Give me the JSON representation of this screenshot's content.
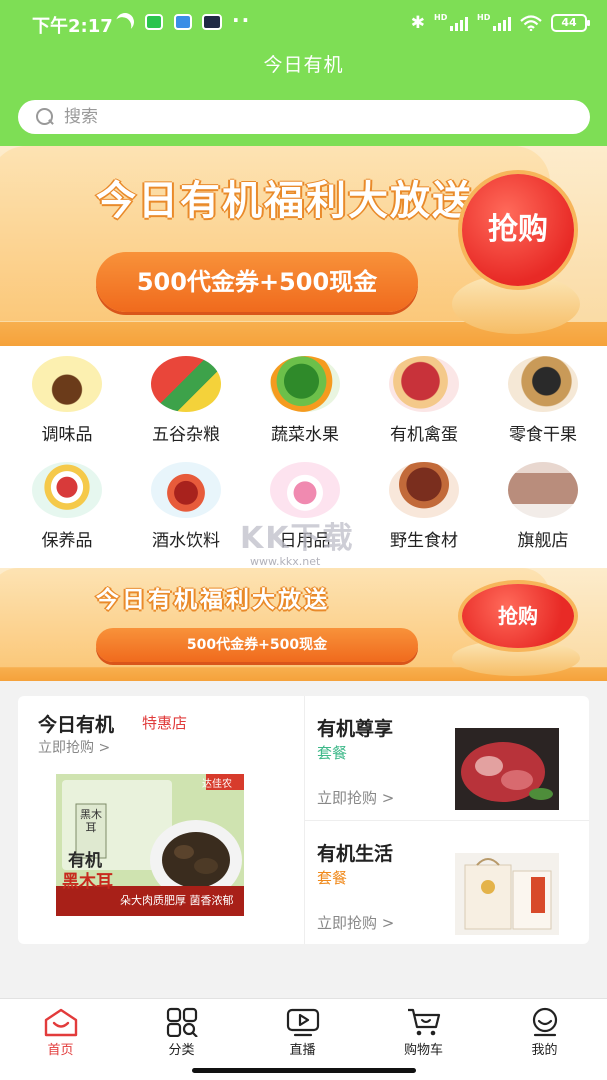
{
  "status_bar": {
    "time": "下午2:17",
    "battery": "44"
  },
  "header": {
    "title": "今日有机"
  },
  "search": {
    "placeholder": "搜索"
  },
  "banners": [
    {
      "headline": "今日有机福利大放送",
      "offer": "500代金券+500现金",
      "button": "抢购"
    },
    {
      "headline": "今日有机福利大放送",
      "offer": "500代金券+500现金",
      "button": "抢购"
    }
  ],
  "categories": [
    {
      "label": "调味品"
    },
    {
      "label": "五谷杂粮"
    },
    {
      "label": "蔬菜水果"
    },
    {
      "label": "有机禽蛋"
    },
    {
      "label": "零食干果"
    },
    {
      "label": "保养品"
    },
    {
      "label": "酒水饮料"
    },
    {
      "label": "日用品"
    },
    {
      "label": "野生食材"
    },
    {
      "label": "旗舰店"
    }
  ],
  "watermark": {
    "text": "KK下载",
    "url": "www.kkx.net"
  },
  "promo": {
    "left": {
      "title": "今日有机",
      "tag": "特惠店",
      "link": "立即抢购 >",
      "product": {
        "brand": "达佳农",
        "line1": "有机",
        "line2": "黑木耳",
        "slogan": "朵大肉质肥厚  菌香浓郁",
        "pack_label": "黑木耳"
      }
    },
    "right": [
      {
        "title": "有机尊享",
        "subtitle": "套餐",
        "link": "立即抢购 >",
        "subtitle_color": "#3fb98a"
      },
      {
        "title": "有机生活",
        "subtitle": "套餐",
        "link": "立即抢购 >",
        "subtitle_color": "#f08a1c"
      }
    ]
  },
  "tabbar": {
    "items": [
      {
        "label": "首页",
        "icon": "home-icon",
        "active": true
      },
      {
        "label": "分类",
        "icon": "category-icon",
        "active": false
      },
      {
        "label": "直播",
        "icon": "live-icon",
        "active": false
      },
      {
        "label": "购物车",
        "icon": "cart-icon",
        "active": false
      },
      {
        "label": "我的",
        "icon": "profile-icon",
        "active": false
      }
    ],
    "active_color": "#e23b3b"
  },
  "colors": {
    "header_green": "#7ede55",
    "accent_red": "#e23b3b"
  }
}
